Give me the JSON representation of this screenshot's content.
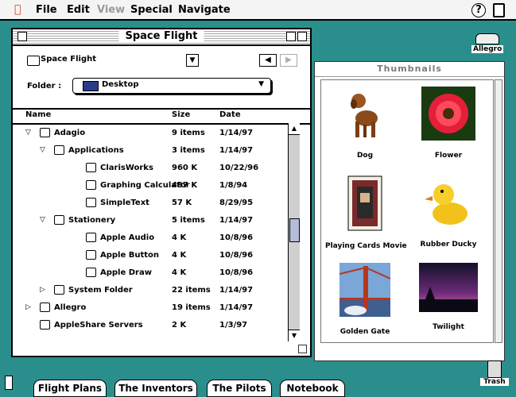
{
  "menubar": {
    "items": [
      "File",
      "Edit",
      "View",
      "Special",
      "Navigate"
    ]
  },
  "finder": {
    "title": "Space Flight",
    "path_label": "Space Flight",
    "folder_label": "Folder :",
    "folder_value": "Desktop",
    "columns": {
      "name": "Name",
      "size": "Size",
      "date": "Date"
    },
    "rows": [
      {
        "name": "Adagio",
        "size": "9 items",
        "date": "1/14/97",
        "level": 0,
        "expand": "open"
      },
      {
        "name": "Applications",
        "size": "3 items",
        "date": "1/14/97",
        "level": 1,
        "expand": "open"
      },
      {
        "name": "ClarisWorks",
        "size": "960 K",
        "date": "10/22/96",
        "level": 2,
        "expand": ""
      },
      {
        "name": "Graphing Calculator",
        "size": "497 K",
        "date": "1/8/94",
        "level": 2,
        "expand": ""
      },
      {
        "name": "SimpleText",
        "size": "57 K",
        "date": "8/29/95",
        "level": 2,
        "expand": ""
      },
      {
        "name": "Stationery",
        "size": "5 items",
        "date": "1/14/97",
        "level": 1,
        "expand": "open"
      },
      {
        "name": "Apple Audio",
        "size": "4 K",
        "date": "10/8/96",
        "level": 2,
        "expand": ""
      },
      {
        "name": "Apple Button",
        "size": "4 K",
        "date": "10/8/96",
        "level": 2,
        "expand": ""
      },
      {
        "name": "Apple Draw",
        "size": "4 K",
        "date": "10/8/96",
        "level": 2,
        "expand": ""
      },
      {
        "name": "System Folder",
        "size": "22 items",
        "date": "1/14/97",
        "level": 1,
        "expand": "closed"
      },
      {
        "name": "Allegro",
        "size": "19 items",
        "date": "1/14/97",
        "level": 0,
        "expand": "closed"
      },
      {
        "name": "AppleShare Servers",
        "size": "2 K",
        "date": "1/3/97",
        "level": 0,
        "expand": ""
      }
    ]
  },
  "thumbnails": {
    "title": "Thumbnails",
    "items": [
      {
        "caption": "Dog",
        "icon": "dog-image"
      },
      {
        "caption": "Flower",
        "icon": "flower-image"
      },
      {
        "caption": "Playing Cards Movie",
        "icon": "playing-cards-image"
      },
      {
        "caption": "Rubber Ducky",
        "icon": "rubber-ducky-image"
      },
      {
        "caption": "Golden Gate",
        "icon": "golden-gate-image"
      },
      {
        "caption": "Twilight",
        "icon": "twilight-image"
      }
    ]
  },
  "desktop": {
    "hd_label": "Allegro",
    "trash_label": "Trash"
  },
  "tabs": [
    "Flight Plans",
    "The Inventors",
    "The Pilots",
    "Notebook"
  ],
  "colors": {
    "desktop": "#2a8f8c",
    "apple": "#d63a1c"
  }
}
